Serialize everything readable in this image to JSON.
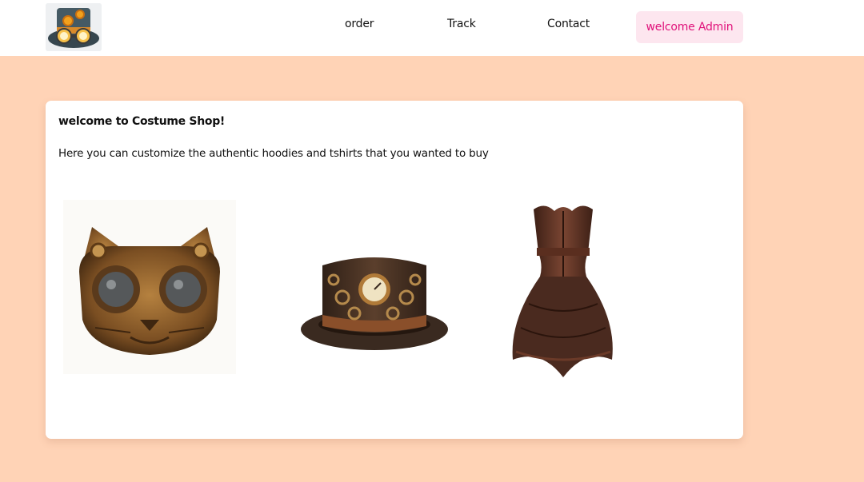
{
  "colors": {
    "page_background": "#ffd3b6",
    "accent_text": "#e0117a",
    "accent_background": "#fde6ef"
  },
  "navbar": {
    "logo_icon": "steampunk-top-hat-goggles-logo",
    "links": [
      {
        "label": "order"
      },
      {
        "label": "Track"
      },
      {
        "label": "Contact"
      }
    ],
    "welcome_label": "welcome Admin"
  },
  "card": {
    "title": "welcome to Costume Shop!",
    "description": "Here you can customize the authentic hoodies and tshirts that you wanted to buy",
    "products": [
      {
        "icon": "steampunk-cat-mask-image"
      },
      {
        "icon": "steampunk-top-hat-image"
      },
      {
        "icon": "corset-dress-image"
      }
    ]
  }
}
